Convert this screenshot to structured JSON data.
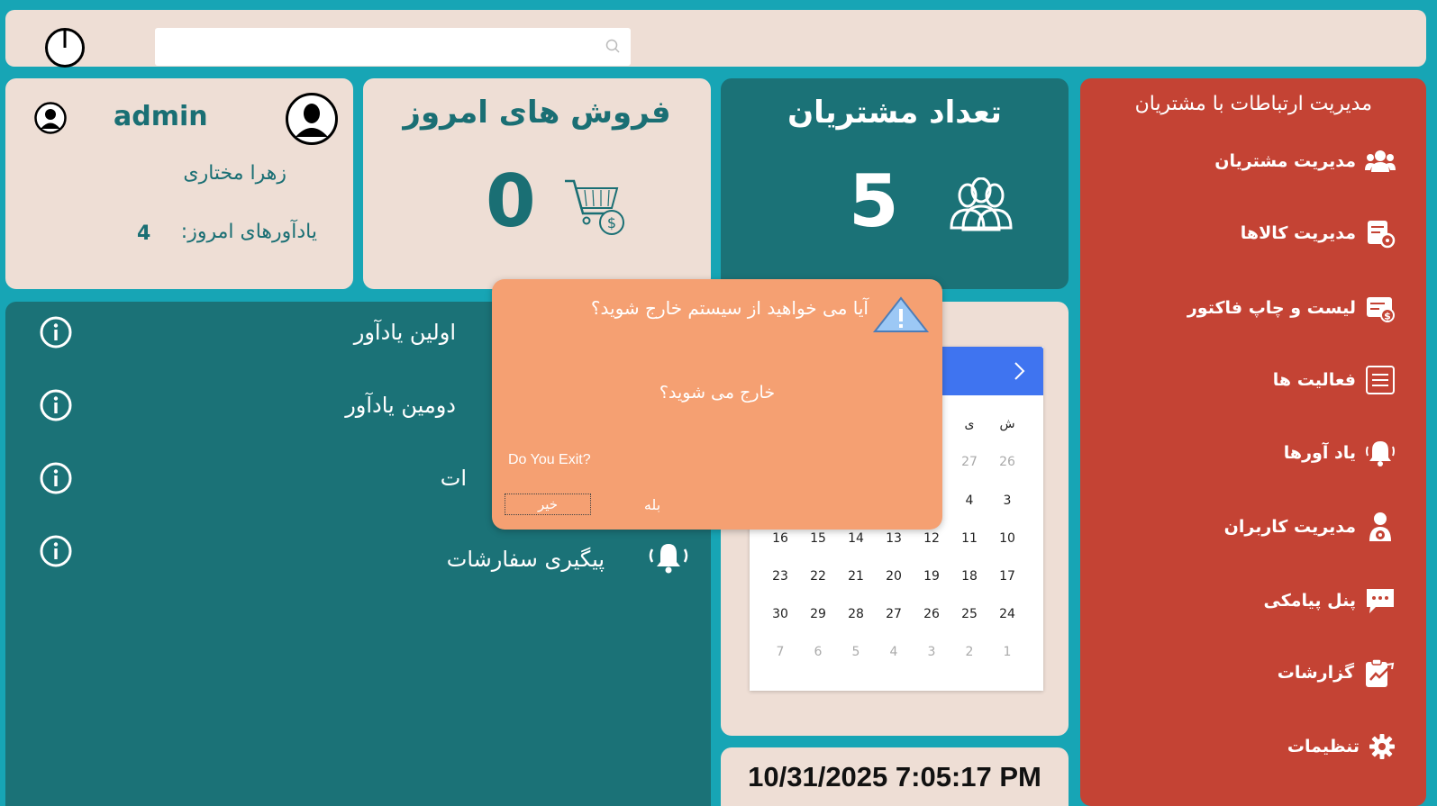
{
  "topbar": {
    "search_placeholder": ""
  },
  "user_card": {
    "username": "admin",
    "full_name": "زهرا مختاری",
    "reminders_label": "یادآورهای امروز:",
    "reminders_count": "4"
  },
  "sales_card": {
    "title": "فروش های امروز",
    "value": "0"
  },
  "customers_card": {
    "title": "تعداد مشتریان",
    "value": "5"
  },
  "crm": {
    "title": "مدیریت ارتباطات با مشتریان",
    "items": [
      {
        "label": "مدیریت مشتریان",
        "icon": "users-icon"
      },
      {
        "label": "مدیریت کالاها",
        "icon": "product-settings-icon"
      },
      {
        "label": "لیست و چاپ فاکتور",
        "icon": "invoice-icon"
      },
      {
        "label": "فعالیت ها",
        "icon": "list-icon"
      },
      {
        "label": "یاد آورها",
        "icon": "bell-icon"
      },
      {
        "label": "مدیریت کاربران",
        "icon": "user-gear-icon"
      },
      {
        "label": "پنل پیامکی",
        "icon": "chat-icon"
      },
      {
        "label": "گزارشات",
        "icon": "report-icon"
      },
      {
        "label": "تنظیمات",
        "icon": "gear-icon"
      }
    ]
  },
  "reminders": {
    "items": [
      {
        "text": "اولین یادآور"
      },
      {
        "text": "دومین یادآور"
      },
      {
        "text": "ات"
      },
      {
        "text": "پیگیری سفارشات"
      }
    ]
  },
  "calendar": {
    "weekday_headers": [
      "ش",
      "ی"
    ],
    "rows": [
      [
        "26",
        "27"
      ],
      [
        "3",
        "4"
      ],
      [
        "10",
        "11",
        "12",
        "13",
        "14",
        "15",
        "16"
      ],
      [
        "17",
        "18",
        "19",
        "20",
        "21",
        "22",
        "23"
      ],
      [
        "24",
        "25",
        "26",
        "27",
        "28",
        "29",
        "30"
      ],
      [
        "1",
        "2",
        "3",
        "4",
        "5",
        "6",
        "7"
      ]
    ]
  },
  "datetime": "10/31/2025 7:05:17 PM",
  "dialog": {
    "title": "آیا می خواهید از سیستم خارج شوید؟",
    "message": "خارج می شوید؟",
    "english": "Do You Exit?",
    "no_label": "خیر",
    "yes_label": "بله"
  },
  "colors": {
    "background": "#17a5b5",
    "beige": "#eeded5",
    "teal": "#1b7277",
    "red": "#c44334",
    "dialog": "#f5a072",
    "calendar_header": "#3f74f0"
  }
}
